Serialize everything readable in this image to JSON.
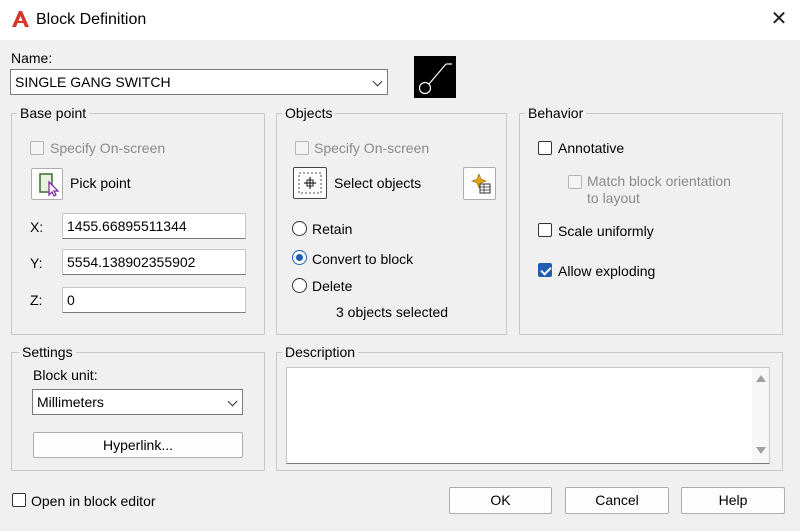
{
  "window": {
    "title": "Block Definition",
    "close_glyph": "✕",
    "logo_color": "#d6372b"
  },
  "name": {
    "label": "Name:",
    "value": "SINGLE GANG SWITCH"
  },
  "base_point": {
    "title": "Base point",
    "specify_onscreen": "Specify On-screen",
    "pick_point": "Pick point",
    "x_label": "X:",
    "x_value": "1455.66895511344",
    "y_label": "Y:",
    "y_value": "5554.138902355902",
    "z_label": "Z:",
    "z_value": "0"
  },
  "objects": {
    "title": "Objects",
    "specify_onscreen": "Specify On-screen",
    "select_objects": "Select objects",
    "retain": "Retain",
    "convert": "Convert to block",
    "delete": "Delete",
    "count": "3 objects selected"
  },
  "behavior": {
    "title": "Behavior",
    "annotative": "Annotative",
    "match_line1": "Match block orientation",
    "match_line2": "to layout",
    "scale_uniformly": "Scale uniformly",
    "allow_exploding": "Allow exploding"
  },
  "settings": {
    "title": "Settings",
    "block_unit_label": "Block unit:",
    "block_unit_value": "Millimeters",
    "hyperlink": "Hyperlink..."
  },
  "description": {
    "title": "Description",
    "value": ""
  },
  "footer": {
    "open_in_editor": "Open in block editor",
    "ok": "OK",
    "cancel": "Cancel",
    "help": "Help"
  },
  "colors": {
    "accent": "#1e5fb4",
    "border": "#c8c8c8",
    "disabled": "#8a8a8a"
  },
  "icons": [
    "autocad-logo-icon",
    "close-icon",
    "block-preview-icon",
    "pick-point-icon",
    "select-objects-icon",
    "quick-select-icon",
    "chevron-down-icon",
    "scroll-up-icon",
    "scroll-down-icon"
  ]
}
